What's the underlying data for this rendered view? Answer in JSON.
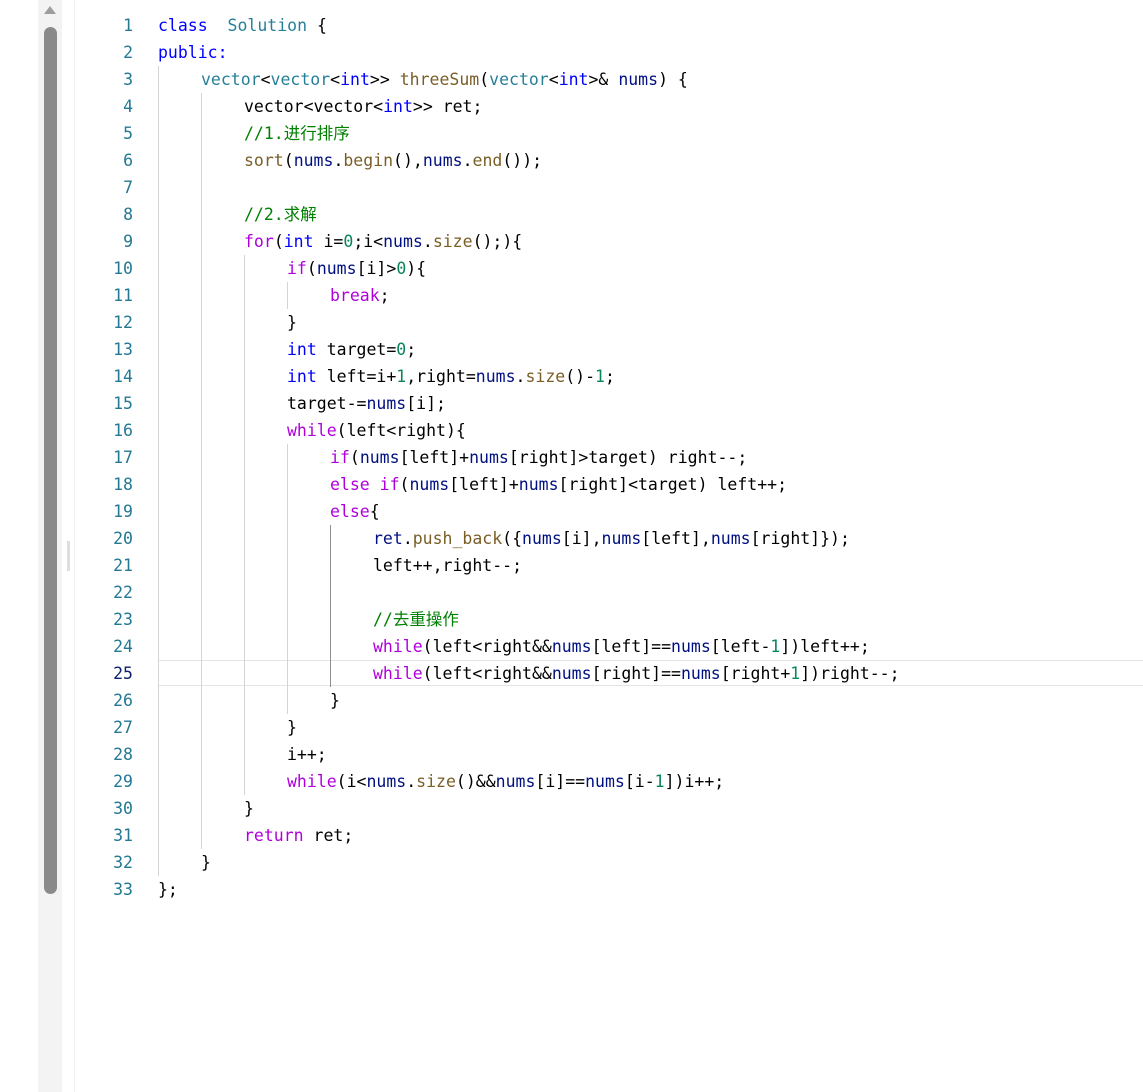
{
  "editor": {
    "language": "cpp",
    "current_line": 25,
    "colors": {
      "background": "#ffffff",
      "line_number": "#237893",
      "keyword": "#0000ff",
      "control": "#af00db",
      "type": "#267f99",
      "function": "#795e26",
      "variable": "#001080",
      "number": "#098658",
      "comment": "#008000"
    },
    "lines": [
      {
        "num": "1",
        "indent": 0,
        "tokens": [
          [
            "kw",
            "class"
          ],
          [
            "",
            "  "
          ],
          [
            "ty",
            "Solution"
          ],
          [
            "",
            " {"
          ]
        ]
      },
      {
        "num": "2",
        "indent": 0,
        "tokens": [
          [
            "kw",
            "public:"
          ]
        ]
      },
      {
        "num": "3",
        "indent": 1,
        "tokens": [
          [
            "ty",
            "vector"
          ],
          [
            "",
            "<"
          ],
          [
            "ty",
            "vector"
          ],
          [
            "",
            "<"
          ],
          [
            "kw",
            "int"
          ],
          [
            "",
            ">> "
          ],
          [
            "fn",
            "threeSum"
          ],
          [
            "",
            "("
          ],
          [
            "ty",
            "vector"
          ],
          [
            "",
            "<"
          ],
          [
            "kw",
            "int"
          ],
          [
            "",
            ">& "
          ],
          [
            "var",
            "nums"
          ],
          [
            "",
            ") {"
          ]
        ]
      },
      {
        "num": "4",
        "indent": 2,
        "tokens": [
          [
            "",
            "vector<vector<"
          ],
          [
            "kw",
            "int"
          ],
          [
            "",
            ">> ret;"
          ]
        ]
      },
      {
        "num": "5",
        "indent": 2,
        "tokens": [
          [
            "cm",
            "//1.进行排序"
          ]
        ]
      },
      {
        "num": "6",
        "indent": 2,
        "tokens": [
          [
            "fn",
            "sort"
          ],
          [
            "",
            "("
          ],
          [
            "var",
            "nums"
          ],
          [
            "",
            "."
          ],
          [
            "fn",
            "begin"
          ],
          [
            "",
            "(),"
          ],
          [
            "var",
            "nums"
          ],
          [
            "",
            "."
          ],
          [
            "fn",
            "end"
          ],
          [
            "",
            "());"
          ]
        ]
      },
      {
        "num": "7",
        "indent": 0,
        "tokens": []
      },
      {
        "num": "8",
        "indent": 2,
        "tokens": [
          [
            "cm",
            "//2.求解"
          ]
        ]
      },
      {
        "num": "9",
        "indent": 2,
        "tokens": [
          [
            "ctl",
            "for"
          ],
          [
            "",
            "("
          ],
          [
            "kw",
            "int"
          ],
          [
            "",
            " i="
          ],
          [
            "num",
            "0"
          ],
          [
            "",
            ";i<"
          ],
          [
            "var",
            "nums"
          ],
          [
            "",
            "."
          ],
          [
            "fn",
            "size"
          ],
          [
            "",
            "();){"
          ]
        ]
      },
      {
        "num": "10",
        "indent": 3,
        "tokens": [
          [
            "ctl",
            "if"
          ],
          [
            "",
            "("
          ],
          [
            "var",
            "nums"
          ],
          [
            "",
            "[i]>"
          ],
          [
            "num",
            "0"
          ],
          [
            "",
            "){"
          ]
        ]
      },
      {
        "num": "11",
        "indent": 4,
        "tokens": [
          [
            "ctl",
            "break"
          ],
          [
            "",
            ";"
          ]
        ]
      },
      {
        "num": "12",
        "indent": 3,
        "tokens": [
          [
            "",
            "}"
          ]
        ]
      },
      {
        "num": "13",
        "indent": 3,
        "tokens": [
          [
            "kw",
            "int"
          ],
          [
            "",
            " target="
          ],
          [
            "num",
            "0"
          ],
          [
            "",
            ";"
          ]
        ]
      },
      {
        "num": "14",
        "indent": 3,
        "tokens": [
          [
            "kw",
            "int"
          ],
          [
            "",
            " left=i+"
          ],
          [
            "num",
            "1"
          ],
          [
            "",
            ",right="
          ],
          [
            "var",
            "nums"
          ],
          [
            "",
            "."
          ],
          [
            "fn",
            "size"
          ],
          [
            "",
            "()-"
          ],
          [
            "num",
            "1"
          ],
          [
            "",
            ";"
          ]
        ]
      },
      {
        "num": "15",
        "indent": 3,
        "tokens": [
          [
            "",
            "target-="
          ],
          [
            "var",
            "nums"
          ],
          [
            "",
            "[i];"
          ]
        ]
      },
      {
        "num": "16",
        "indent": 3,
        "tokens": [
          [
            "ctl",
            "while"
          ],
          [
            "",
            "(left<right){"
          ]
        ]
      },
      {
        "num": "17",
        "indent": 4,
        "tokens": [
          [
            "ctl",
            "if"
          ],
          [
            "",
            "("
          ],
          [
            "var",
            "nums"
          ],
          [
            "",
            "[left]+"
          ],
          [
            "var",
            "nums"
          ],
          [
            "",
            "[right]>target) right--;"
          ]
        ]
      },
      {
        "num": "18",
        "indent": 4,
        "tokens": [
          [
            "ctl",
            "else if"
          ],
          [
            "",
            "("
          ],
          [
            "var",
            "nums"
          ],
          [
            "",
            "[left]+"
          ],
          [
            "var",
            "nums"
          ],
          [
            "",
            "[right]<target) left++;"
          ]
        ]
      },
      {
        "num": "19",
        "indent": 4,
        "tokens": [
          [
            "ctl",
            "else"
          ],
          [
            "",
            "{"
          ]
        ]
      },
      {
        "num": "20",
        "indent": 5,
        "tokens": [
          [
            "var",
            "ret"
          ],
          [
            "",
            "."
          ],
          [
            "fn",
            "push_back"
          ],
          [
            "",
            "({"
          ],
          [
            "var",
            "nums"
          ],
          [
            "",
            "[i],"
          ],
          [
            "var",
            "nums"
          ],
          [
            "",
            "[left],"
          ],
          [
            "var",
            "nums"
          ],
          [
            "",
            "[right]});"
          ]
        ]
      },
      {
        "num": "21",
        "indent": 5,
        "tokens": [
          [
            "",
            "left++,right--;"
          ]
        ]
      },
      {
        "num": "22",
        "indent": 0,
        "tokens": []
      },
      {
        "num": "23",
        "indent": 5,
        "tokens": [
          [
            "cm",
            "//去重操作"
          ]
        ]
      },
      {
        "num": "24",
        "indent": 5,
        "tokens": [
          [
            "ctl",
            "while"
          ],
          [
            "",
            "(left<right&&"
          ],
          [
            "var",
            "nums"
          ],
          [
            "",
            "[left]=="
          ],
          [
            "var",
            "nums"
          ],
          [
            "",
            "[left-"
          ],
          [
            "num",
            "1"
          ],
          [
            "",
            "])left++;"
          ]
        ]
      },
      {
        "num": "25",
        "indent": 5,
        "tokens": [
          [
            "ctl",
            "while"
          ],
          [
            "",
            "(left<right&&"
          ],
          [
            "var",
            "nums"
          ],
          [
            "",
            "[right]=="
          ],
          [
            "var",
            "nums"
          ],
          [
            "",
            "[right+"
          ],
          [
            "num",
            "1"
          ],
          [
            "",
            "])right--;"
          ]
        ]
      },
      {
        "num": "26",
        "indent": 4,
        "tokens": [
          [
            "",
            "}"
          ]
        ]
      },
      {
        "num": "27",
        "indent": 3,
        "tokens": [
          [
            "",
            "}"
          ]
        ]
      },
      {
        "num": "28",
        "indent": 3,
        "tokens": [
          [
            "",
            "i++;"
          ]
        ]
      },
      {
        "num": "29",
        "indent": 3,
        "tokens": [
          [
            "ctl",
            "while"
          ],
          [
            "",
            "(i<"
          ],
          [
            "var",
            "nums"
          ],
          [
            "",
            "."
          ],
          [
            "fn",
            "size"
          ],
          [
            "",
            "()&&"
          ],
          [
            "var",
            "nums"
          ],
          [
            "",
            "[i]=="
          ],
          [
            "var",
            "nums"
          ],
          [
            "",
            "[i-"
          ],
          [
            "num",
            "1"
          ],
          [
            "",
            "])i++;"
          ]
        ]
      },
      {
        "num": "30",
        "indent": 2,
        "tokens": [
          [
            "",
            "}"
          ]
        ]
      },
      {
        "num": "31",
        "indent": 2,
        "tokens": [
          [
            "ctl",
            "return"
          ],
          [
            "",
            " ret;"
          ]
        ]
      },
      {
        "num": "32",
        "indent": 1,
        "tokens": [
          [
            "",
            "}"
          ]
        ]
      },
      {
        "num": "33",
        "indent": 0,
        "tokens": [
          [
            "",
            "};"
          ]
        ]
      }
    ]
  }
}
